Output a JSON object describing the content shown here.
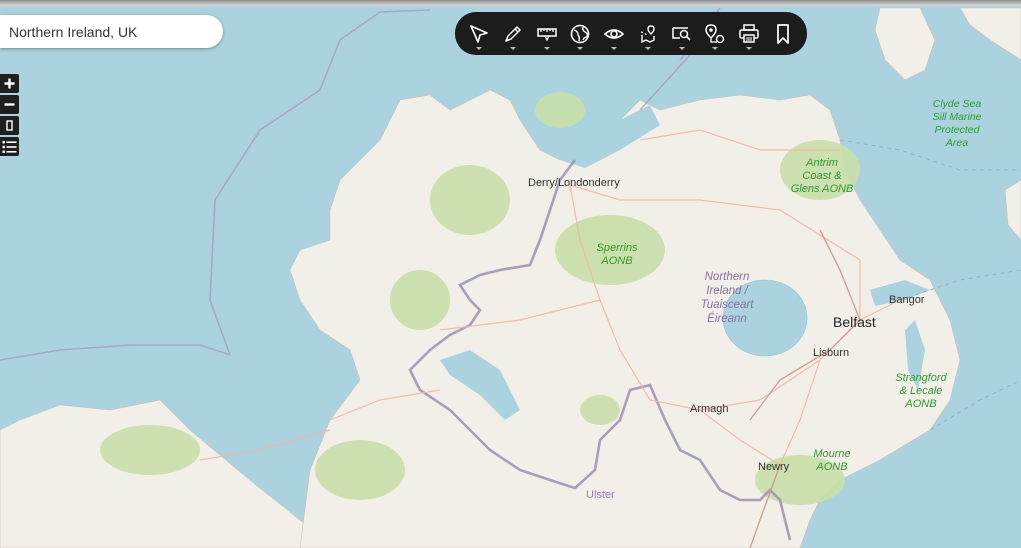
{
  "search": {
    "value": "Northern Ireland, UK",
    "placeholder": ""
  },
  "zoom_controls": [
    {
      "name": "zoom-in-button",
      "icon": "plus-icon"
    },
    {
      "name": "zoom-out-button",
      "icon": "minus-icon"
    },
    {
      "name": "fullscreen-button",
      "icon": "rectangle-icon"
    },
    {
      "name": "layers-list-button",
      "icon": "list-icon"
    }
  ],
  "toolbar": {
    "tools": [
      {
        "name": "select-tool",
        "icon": "cursor-icon"
      },
      {
        "name": "draw-tool",
        "icon": "pencil-icon"
      },
      {
        "name": "measure-tool",
        "icon": "ruler-icon"
      },
      {
        "name": "basemap-tool",
        "icon": "globe-icon"
      },
      {
        "name": "view-tool",
        "icon": "eye-icon"
      },
      {
        "name": "route-tool",
        "icon": "route-icon"
      },
      {
        "name": "search-area-tool",
        "icon": "zoom-search-icon"
      },
      {
        "name": "place-marker-tool",
        "icon": "pin-icon"
      },
      {
        "name": "print-tool",
        "icon": "printer-icon"
      },
      {
        "name": "bookmark-tool",
        "icon": "bookmark-icon"
      }
    ]
  },
  "map_labels": {
    "derry": "Derry/Londonderry",
    "sperrins_1": "Sperrins",
    "sperrins_2": "AONB",
    "ni_1": "Northern",
    "ni_2": "Ireland /",
    "ni_3": "Tuaisceart",
    "ni_4": "Éireann",
    "antrim_1": "Antrim",
    "antrim_2": "Coast &",
    "antrim_3": "Glens AONB",
    "clyde_1": "Clyde Sea",
    "clyde_2": "Sill Marine",
    "clyde_3": "Protected",
    "clyde_4": "Area",
    "bangor": "Bangor",
    "belfast": "Belfast",
    "lisburn": "Lisburn",
    "strangford_1": "Strangford",
    "strangford_2": "& Lecale",
    "strangford_3": "AONB",
    "armagh": "Armagh",
    "mourne_1": "Mourne",
    "mourne_2": "AONB",
    "newry": "Newry",
    "ulster": "Ulster"
  },
  "colors": {
    "water": "#aad3df",
    "land": "#f2efe9",
    "forest": "#c8dfa8",
    "road": "#f0b8a0",
    "border": "#a896b8",
    "park_label": "#2e9b2e"
  }
}
